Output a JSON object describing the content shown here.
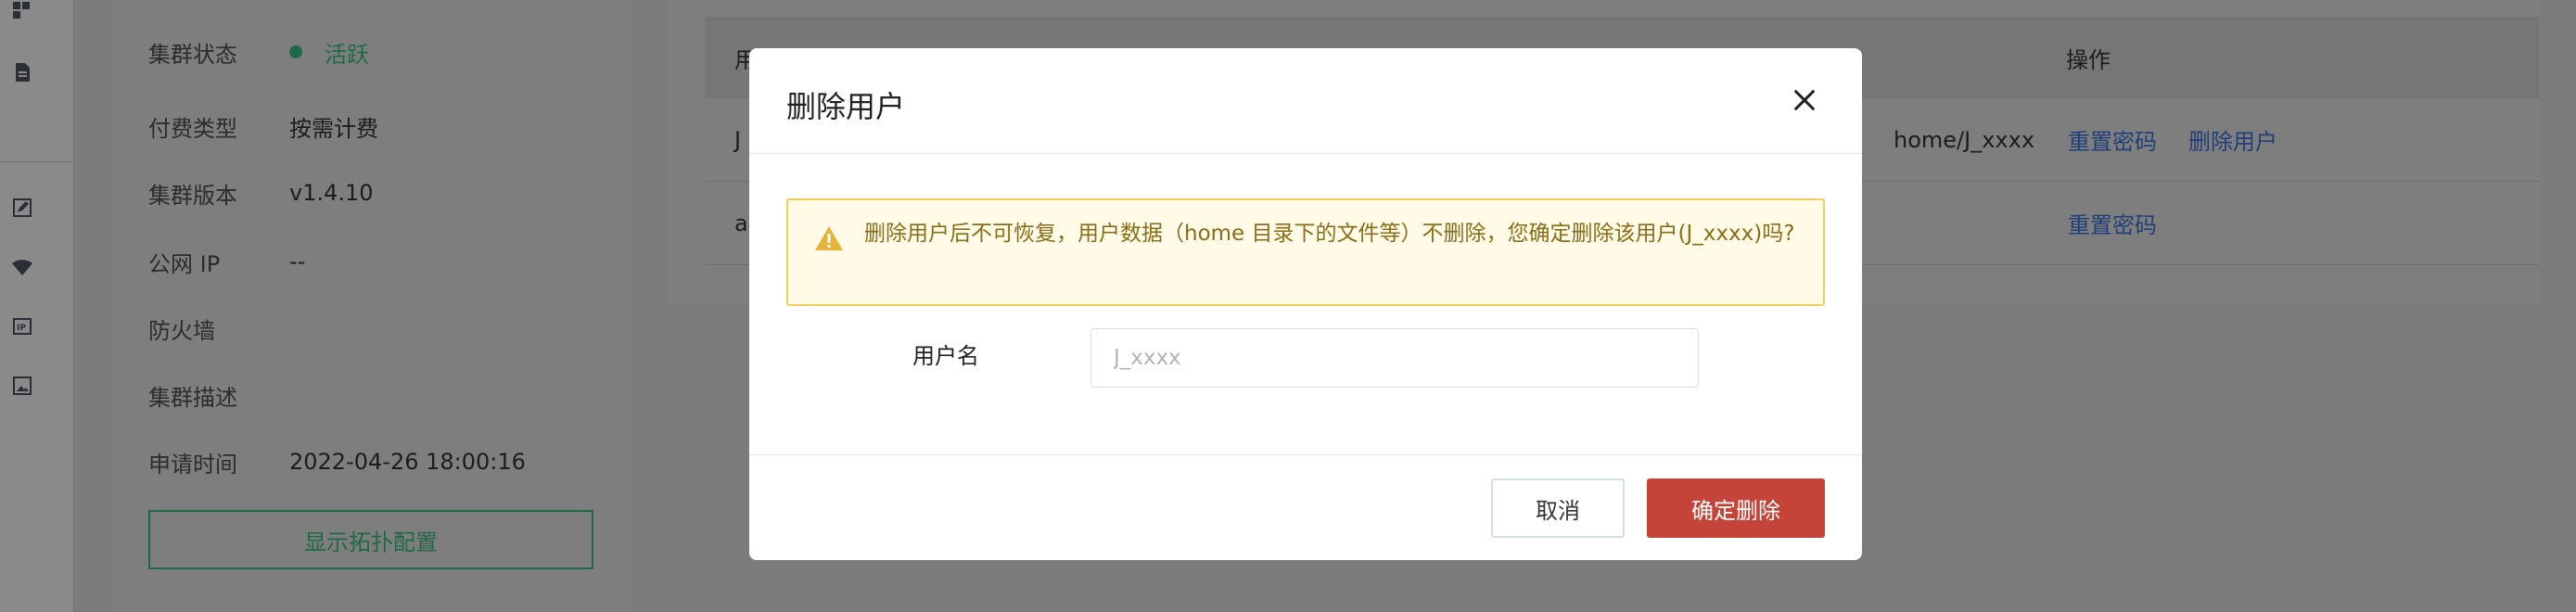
{
  "cluster_info": {
    "rows": [
      {
        "label": "集群状态",
        "value": "活跃",
        "status": "active"
      },
      {
        "label": "付费类型",
        "value": "按需计费"
      },
      {
        "label": "集群版本",
        "value": "v1.4.10"
      },
      {
        "label": "公网 IP",
        "value": "--"
      },
      {
        "label": "防火墙",
        "value": ""
      },
      {
        "label": "集群描述",
        "value": ""
      },
      {
        "label": "申请时间",
        "value": "2022-04-26 18:00:16"
      }
    ],
    "topology_button": "显示拓扑配置"
  },
  "users_table": {
    "header_first_visible": "用",
    "header_actions": "操作",
    "rows": [
      {
        "first_visible": "J",
        "home_fragment": "home/J_xxxx",
        "actions": [
          "重置密码",
          "删除用户"
        ]
      },
      {
        "first_visible": "a",
        "home_fragment": "",
        "actions": [
          "重置密码"
        ]
      }
    ]
  },
  "modal": {
    "title": "删除用户",
    "warning": "删除用户后不可恢复，用户数据（home 目录下的文件等）不删除，您确定删除该用户(J_xxxx)吗?",
    "username_label": "用户名",
    "username_placeholder": "J_xxxx",
    "cancel_label": "取消",
    "confirm_label": "确定删除"
  },
  "colors": {
    "active_green": "#1f6a45",
    "warning_bg": "#fffbe6",
    "warning_border": "#f0cc5a",
    "danger": "#c5443a",
    "link": "#1f3f7a"
  },
  "icons": [
    "grid-icon",
    "document-icon",
    "edit-icon",
    "wifi-icon",
    "ip-icon",
    "image-icon",
    "close-icon",
    "warning-icon"
  ]
}
